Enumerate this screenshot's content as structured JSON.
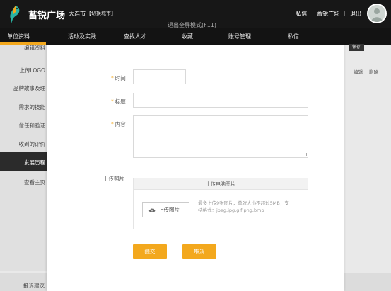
{
  "header": {
    "app_name": "蓄锐广场",
    "city": "大连市",
    "switch_city": "【切换城市】",
    "links": [
      "私信",
      "蓄锐广场",
      "退出"
    ],
    "separator": "|",
    "exit_fullscreen": "退出全屏模式(F11)"
  },
  "nav": {
    "items": [
      "单位资料",
      "活动及实践",
      "查找人才",
      "收藏",
      "账号管理",
      "私信"
    ],
    "active": "单位资料",
    "accent_color": "#f3a81d"
  },
  "sidebar": {
    "items": [
      "编辑资料",
      "上传LOGO",
      "品牌故事及理",
      "需求的技能",
      "信任和验证",
      "收到的评价",
      "发展历程",
      "查看主页"
    ],
    "active": "发展历程"
  },
  "underlay": {
    "right_tag": "保存",
    "edit": "编辑",
    "delete": "删除",
    "footer_link": "投诉建议"
  },
  "modal": {
    "time_label": "时间",
    "title_label": "标题",
    "content_label": "内容",
    "required_mark": "*",
    "photo_label": "上传照片",
    "upload_header": "上传电脑图片",
    "upload_button": "上传图片",
    "upload_hint": "最多上传9张图片，单张大小不超过5MB，支持格式：jpeg,jpg,gif,png,bmp",
    "submit": "提交",
    "cancel": "取消",
    "upload_icon": "cloud-upload-icon"
  }
}
